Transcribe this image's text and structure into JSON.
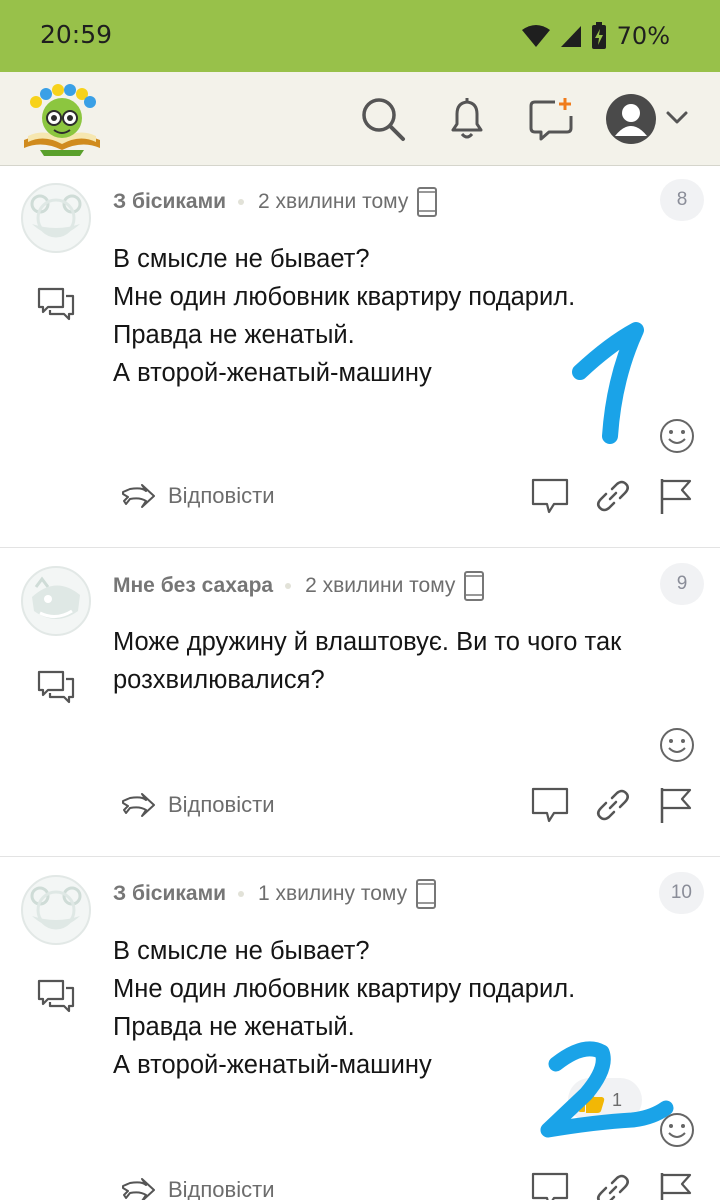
{
  "status_bar": {
    "time": "20:59",
    "battery": "70%"
  },
  "comments": [
    {
      "author": "З бісиками",
      "time": "2 хвилини тому",
      "number": "8",
      "lines": [
        "В смысле не бывает?",
        "Мне один любовник квартиру подарил.",
        "Правда не женатый.",
        "А второй-женатый-машину"
      ],
      "reply_label": "Відповісти"
    },
    {
      "author": "Мне без сахара",
      "time": "2 хвилини тому",
      "number": "9",
      "lines": [
        "Може дружину й влаштовує. Ви то чого так",
        "розхвилювалися?"
      ],
      "reply_label": "Відповісти"
    },
    {
      "author": "З бісиками",
      "time": "1 хвилину тому",
      "number": "10",
      "lines": [
        "В смысле не бывает?",
        "Мне один любовник квартиру подарил.",
        "Правда не женатый.",
        "А второй-женатый-машину"
      ],
      "reply_label": "Відповісти",
      "reaction_count": "1"
    }
  ],
  "annotations": [
    "1",
    "2"
  ],
  "colors": {
    "status_bar": "#98c14a",
    "header_bg": "#f3f2ea",
    "annotation": "#1aa3e8",
    "icon_gray": "#555555"
  }
}
